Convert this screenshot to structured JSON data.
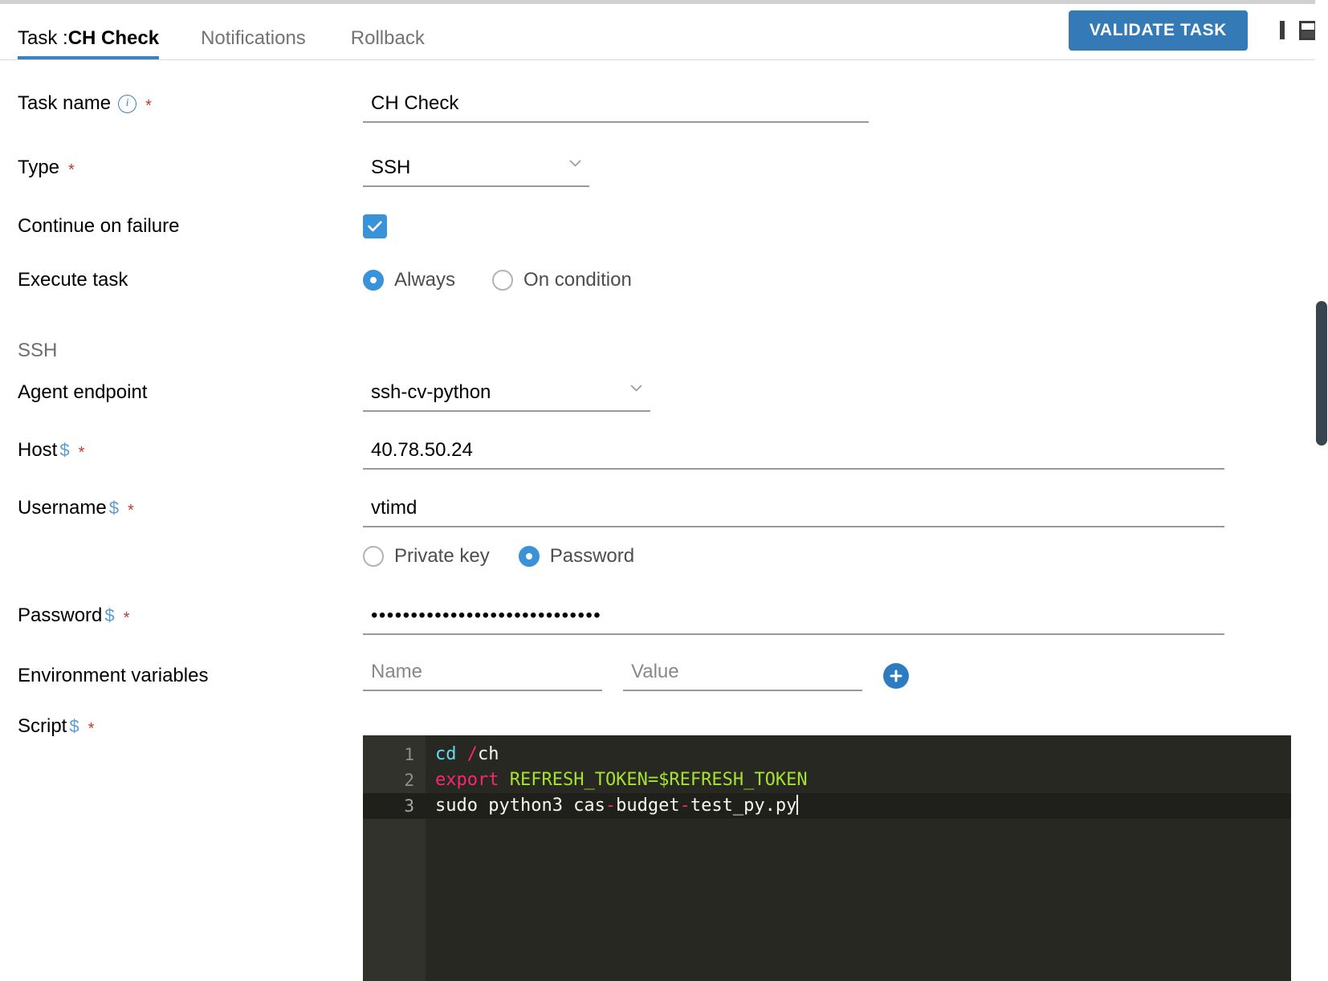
{
  "window": {
    "tabs": [
      {
        "name": "tab-task",
        "prefix": "Task :",
        "strong": "CH Check",
        "active": true
      },
      {
        "name": "tab-notifications",
        "label": "Notifications",
        "active": false
      },
      {
        "name": "tab-rollback",
        "label": "Rollback",
        "active": false
      }
    ],
    "validate_button": "VALIDATE TASK",
    "controls": {
      "minimize": "minimize-icon",
      "maximize": "maximize-icon",
      "split": "split-view-icon"
    },
    "accent_color": "#337ab7"
  },
  "form": {
    "task_name": {
      "label": "Task name",
      "info_icon": "info-icon",
      "required": "*",
      "value": "CH Check"
    },
    "type": {
      "label": "Type",
      "required": "*",
      "value": "SSH",
      "options": [
        "SSH"
      ]
    },
    "continue_on_failure": {
      "label": "Continue on failure",
      "checked": true
    },
    "execute_task": {
      "label": "Execute task",
      "options": [
        {
          "label": "Always",
          "selected": true
        },
        {
          "label": "On condition",
          "selected": false
        }
      ]
    },
    "ssh_section": {
      "title": "SSH",
      "agent_endpoint": {
        "label": "Agent endpoint",
        "value": "ssh-cv-python",
        "options": [
          "ssh-cv-python"
        ]
      },
      "host": {
        "label": "Host",
        "dollar": "$",
        "required": "*",
        "value": "40.78.50.24"
      },
      "username": {
        "label": "Username",
        "dollar": "$",
        "required": "*",
        "value": "vtimd"
      },
      "auth_method": {
        "options": [
          {
            "label": "Private key",
            "selected": false
          },
          {
            "label": "Password",
            "selected": true
          }
        ]
      },
      "password": {
        "label": "Password",
        "dollar": "$",
        "required": "*",
        "value": "•••••••••••••••••••••••••••••"
      },
      "env_variables": {
        "label": "Environment variables",
        "name_placeholder": "Name",
        "name_value": "",
        "value_placeholder": "Value",
        "value_value": "",
        "add_icon": "plus-icon"
      },
      "script": {
        "label": "Script",
        "dollar": "$",
        "required": "*",
        "lines": [
          {
            "number": "1",
            "active": false,
            "tokens": [
              {
                "text": "cd",
                "color": "cyan"
              },
              {
                "text": " ",
                "color": "white"
              },
              {
                "text": "/",
                "color": "pink"
              },
              {
                "text": "ch",
                "color": "white"
              }
            ]
          },
          {
            "number": "2",
            "active": false,
            "tokens": [
              {
                "text": "export",
                "color": "pink"
              },
              {
                "text": " ",
                "color": "white"
              },
              {
                "text": "REFRESH_TOKEN=$REFRESH_TOKEN",
                "color": "green"
              }
            ]
          },
          {
            "number": "3",
            "active": true,
            "tokens": [
              {
                "text": "sudo python3 cas",
                "color": "white"
              },
              {
                "text": "-",
                "color": "pink"
              },
              {
                "text": "budget",
                "color": "white"
              },
              {
                "text": "-",
                "color": "pink"
              },
              {
                "text": "test_py.py",
                "color": "white"
              }
            ]
          }
        ]
      }
    }
  }
}
